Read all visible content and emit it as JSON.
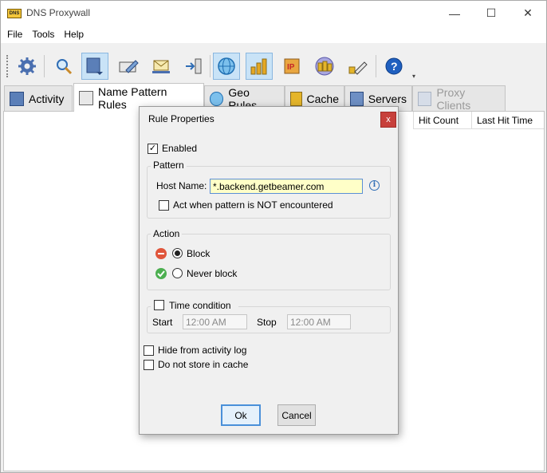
{
  "window": {
    "title": "DNS Proxywall",
    "icon_label": "DNS",
    "controls": {
      "minimize": "—",
      "maximize": "☐",
      "close": "✕"
    }
  },
  "menu": [
    "File",
    "Tools",
    "Help"
  ],
  "toolbar": {
    "buttons": [
      {
        "name": "settings-icon"
      },
      {
        "name": "search-icon"
      },
      {
        "name": "rules-icon",
        "active": true
      },
      {
        "name": "edit-icon"
      },
      {
        "name": "mail-icon"
      },
      {
        "name": "export-icon"
      },
      {
        "name": "globe-icon",
        "active": true
      },
      {
        "name": "stats-icon",
        "active": true
      },
      {
        "name": "ip-icon"
      },
      {
        "name": "coins-icon"
      },
      {
        "name": "clear-icon"
      },
      {
        "name": "help-icon"
      }
    ],
    "overflow": "▾"
  },
  "tabs": [
    {
      "label": "Activity",
      "state": "normal"
    },
    {
      "label": "Name Pattern Rules",
      "state": "selected"
    },
    {
      "label": "Geo Rules",
      "state": "normal"
    },
    {
      "label": "Cache",
      "state": "normal"
    },
    {
      "label": "Servers",
      "state": "normal"
    },
    {
      "label": "Proxy Clients",
      "state": "disabled"
    }
  ],
  "columns": [
    "Hit Count",
    "Last Hit Time"
  ],
  "dialog": {
    "title": "Rule Properties",
    "close": "x",
    "enabled": {
      "label": "Enabled",
      "checked": true
    },
    "pattern": {
      "group_label": "Pattern",
      "host_label": "Host Name:",
      "host_value": "*.backend.getbeamer.com",
      "info": "i",
      "negate": {
        "label": "Act when pattern is NOT encountered",
        "checked": false
      }
    },
    "action": {
      "group_label": "Action",
      "options": [
        {
          "label": "Block",
          "selected": true,
          "color": "#e0553b"
        },
        {
          "label": "Never block",
          "selected": false,
          "color": "#4caf50"
        }
      ]
    },
    "time": {
      "label": "Time condition",
      "checked": false,
      "start_label": "Start",
      "start_value": "12:00 AM",
      "stop_label": "Stop",
      "stop_value": "12:00 AM"
    },
    "hide_log": {
      "label": "Hide from activity log",
      "checked": false
    },
    "no_cache": {
      "label": "Do not store in cache",
      "checked": false
    },
    "ok": "Ok",
    "cancel": "Cancel"
  }
}
